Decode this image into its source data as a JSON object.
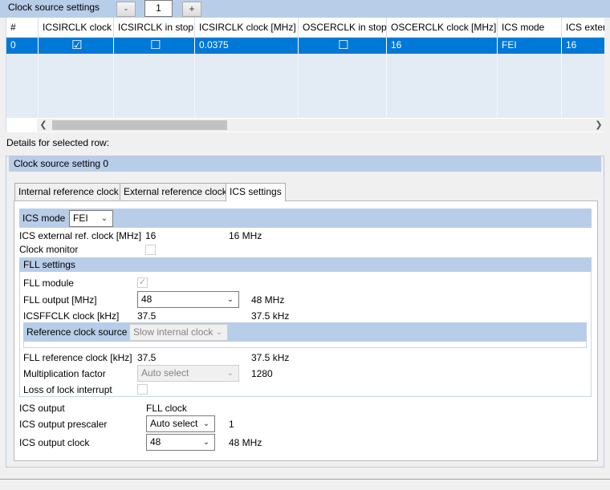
{
  "toolbar": {
    "title": "Clock source settings",
    "minus_label": "-",
    "count": "1",
    "plus_label": "+"
  },
  "grid": {
    "columns": [
      "#",
      "ICSIRCLK clock",
      "ICSIRCLK in stop",
      "ICSIRCLK clock [MHz]",
      "OSCERCLK in stop",
      "OSCERCLK clock [MHz]",
      "ICS mode",
      "ICS extern"
    ],
    "row": {
      "index": "0",
      "icsirclk_clock": "☑",
      "icsirclk_in_stop": "☐",
      "icsirclk_mhz": "0.0375",
      "oscerclk_in_stop": "☐",
      "oscerclk_mhz": "16",
      "ics_mode": "FEI",
      "ics_ext": "16"
    },
    "selected_row_color": "#0078d7"
  },
  "details_label": "Details for selected row:",
  "details": {
    "group_title": "Clock source setting 0",
    "tabs": [
      "Internal reference clock",
      "External reference clock",
      "ICS settings"
    ],
    "active_tab": "ICS settings",
    "ics_mode_label": "ICS mode",
    "ics_mode_value": "FEI",
    "ext_ref_label": "ICS external ref. clock [MHz]",
    "ext_ref_value": "16",
    "ext_ref_display": "16 MHz",
    "clock_monitor_label": "Clock monitor",
    "fll_header": "FLL settings",
    "fll_module_label": "FLL module",
    "fll_output_label": "FLL output [MHz]",
    "fll_output_value": "48",
    "fll_output_display": "48 MHz",
    "icsffclk_label": "ICSFFCLK clock [kHz]",
    "icsffclk_value": "37.5",
    "icsffclk_display": "37.5 kHz",
    "ref_src_label": "Reference clock source",
    "ref_src_value": "Slow internal clock",
    "fll_ref_label": "FLL reference clock [kHz]",
    "fll_ref_value": "37.5",
    "fll_ref_display": "37.5 kHz",
    "mult_label": "Multiplication factor",
    "mult_value": "Auto select",
    "mult_display": "1280",
    "lol_label": "Loss of lock interrupt",
    "ics_output_label": "ICS output",
    "ics_output_value": "FLL clock",
    "prescaler_label": "ICS output prescaler",
    "prescaler_value": "Auto select",
    "prescaler_display": "1",
    "out_clock_label": "ICS output clock",
    "out_clock_value": "48",
    "out_clock_display": "48 MHz"
  },
  "colors": {
    "section_bar": "#b8cde8",
    "selection": "#0078d7",
    "empty_row": "#e3ebf5"
  }
}
